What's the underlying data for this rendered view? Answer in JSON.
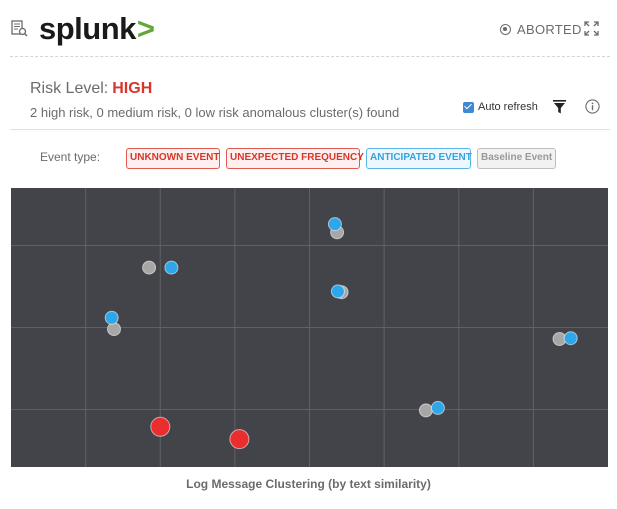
{
  "header": {
    "logo_text": "splunk",
    "logo_chevron": ">",
    "status_text": "ABORTED",
    "icons": {
      "report": "report-search-icon",
      "status": "aborted-circle-icon",
      "expand": "expand-icon"
    }
  },
  "summary": {
    "risk_label": "Risk Level:",
    "risk_value": "HIGH",
    "subtitle": "2 high risk, 0 medium risk, 0 low risk anomalous cluster(s) found",
    "auto_refresh_label": "Auto refresh",
    "auto_refresh_checked": true,
    "icons": {
      "filter": "filter-icon",
      "info": "info-icon"
    }
  },
  "event_types": {
    "label": "Event type:",
    "tags": [
      {
        "label": "UNKNOWN EVENT",
        "color": "#d6362b"
      },
      {
        "label": "UNEXPECTED FREQUENCY",
        "color": "#d6362b"
      },
      {
        "label": "ANTICIPATED EVENT",
        "color": "#33a3e0"
      },
      {
        "label": "Baseline Event",
        "color": "#999999"
      }
    ]
  },
  "colors": {
    "plot_background": "#43444a",
    "grid": "#5f6066",
    "unknown": "#ea2e2e",
    "anticipated": "#2ea6ea",
    "baseline": "#a7a7a7",
    "risk_high": "#d6362b",
    "logo_chevron": "#65a637"
  },
  "chart_data": {
    "type": "scatter",
    "title": "",
    "xlabel": "Log Message Clustering (by text similarity)",
    "ylabel": "",
    "xlim": [
      0,
      8
    ],
    "ylim": [
      0,
      3.4
    ],
    "grid": true,
    "series": [
      {
        "name": "Baseline Event",
        "color_key": "baseline",
        "points": [
          {
            "x": 4.37,
            "y": 2.86
          },
          {
            "x": 1.85,
            "y": 2.43
          },
          {
            "x": 4.43,
            "y": 2.13
          },
          {
            "x": 1.38,
            "y": 1.68
          },
          {
            "x": 7.35,
            "y": 1.56
          },
          {
            "x": 5.56,
            "y": 0.69
          }
        ]
      },
      {
        "name": "ANTICIPATED EVENT",
        "color_key": "anticipated",
        "points": [
          {
            "x": 4.34,
            "y": 2.96
          },
          {
            "x": 2.15,
            "y": 2.43
          },
          {
            "x": 4.38,
            "y": 2.14
          },
          {
            "x": 1.35,
            "y": 1.82
          },
          {
            "x": 7.5,
            "y": 1.57
          },
          {
            "x": 5.72,
            "y": 0.72
          }
        ]
      },
      {
        "name": "UNKNOWN EVENT",
        "color_key": "unknown",
        "points": [
          {
            "x": 2.0,
            "y": 0.49
          },
          {
            "x": 3.06,
            "y": 0.34
          }
        ]
      }
    ]
  }
}
